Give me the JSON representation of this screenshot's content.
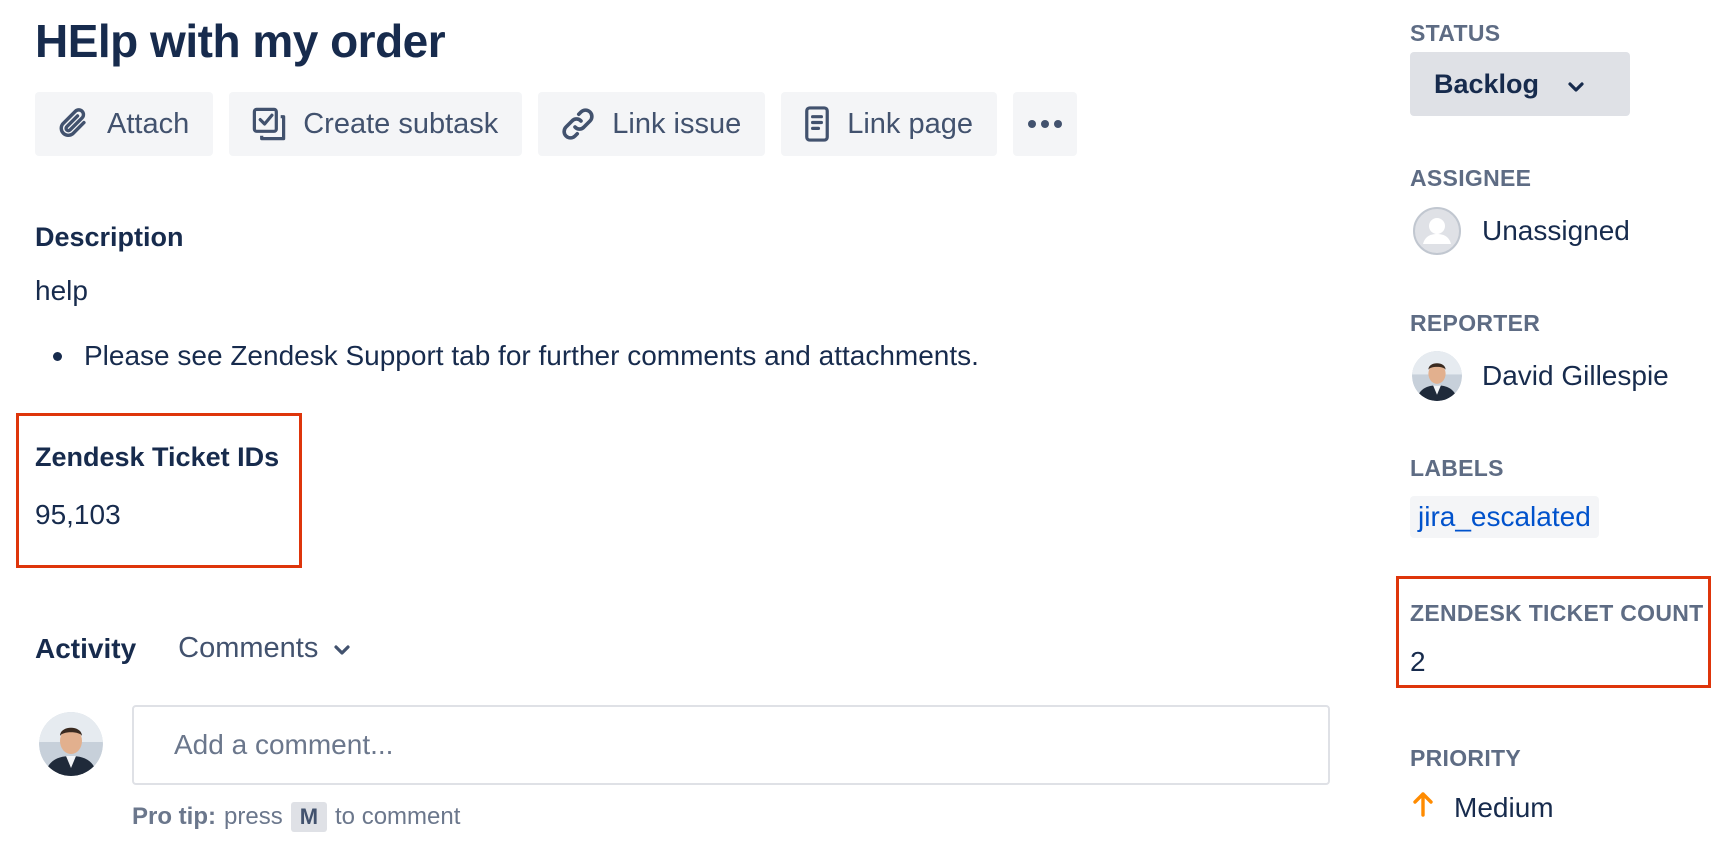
{
  "issue": {
    "title": "HElp with my order"
  },
  "toolbar": {
    "attach": "Attach",
    "create_subtask": "Create subtask",
    "link_issue": "Link issue",
    "link_page": "Link page",
    "more_icon": "more-horizontal-icon"
  },
  "description": {
    "heading": "Description",
    "text": "help",
    "bullet": "Please see Zendesk Support tab for further comments and attachments."
  },
  "zendesk_ids": {
    "heading": "Zendesk Ticket IDs",
    "value": "95,103"
  },
  "activity": {
    "heading": "Activity",
    "filter": "Comments",
    "comment_placeholder": "Add a comment...",
    "protip_label": "Pro tip:",
    "protip_press": "press",
    "protip_key": "M",
    "protip_suffix": "to comment"
  },
  "sidebar": {
    "status_label": "STATUS",
    "status_value": "Backlog",
    "assignee_label": "ASSIGNEE",
    "assignee_value": "Unassigned",
    "reporter_label": "REPORTER",
    "reporter_value": "David Gillespie",
    "labels_label": "LABELS",
    "labels_value": "jira_escalated",
    "ticket_count_label": "ZENDESK TICKET COUNT",
    "ticket_count_value": "2",
    "priority_label": "PRIORITY",
    "priority_value": "Medium"
  },
  "colors": {
    "highlight": "#de350b",
    "priority_medium": "#ff8b00",
    "link": "#0052cc"
  }
}
